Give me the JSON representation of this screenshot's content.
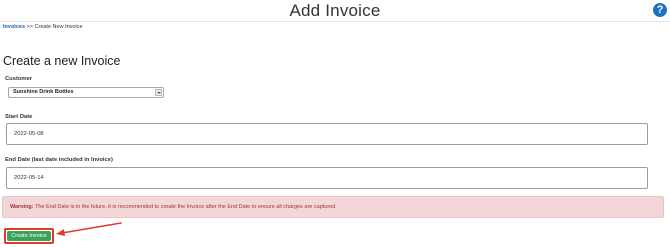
{
  "header": {
    "title": "Add Invoice",
    "help_icon": "?"
  },
  "breadcrumb": {
    "link": "Invoices",
    "separator": ">>",
    "current": "Create New Invoice"
  },
  "page_title": "Create a new Invoice",
  "form": {
    "customer": {
      "label": "Customer",
      "value": "Sunshine Drink Bottles"
    },
    "start_date": {
      "label": "Start Date",
      "value": "2022-05-08"
    },
    "end_date": {
      "label": "End Date (last date included in Invoice)",
      "value": "2022-05-14"
    }
  },
  "warning": {
    "prefix": "Warning:",
    "message": "The End Date is in the future, it is recommended to create the Invoice after the End Date to ensure all charges are captured."
  },
  "actions": {
    "create_label": "Create Invoice"
  },
  "colors": {
    "accent": "#1e73be",
    "primary_button": "#3aa35b",
    "warning_bg": "#f3d7d8",
    "warning_text": "#a33138",
    "highlight": "#e23a2a"
  }
}
